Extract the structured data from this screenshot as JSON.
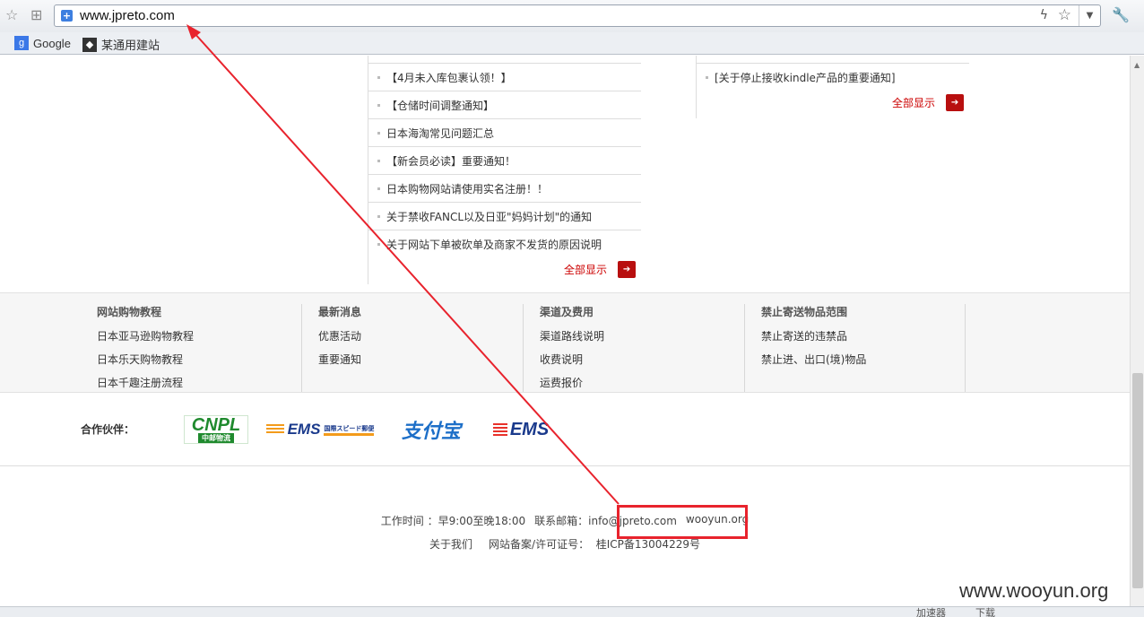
{
  "browser": {
    "url": "www.jpreto.com",
    "bookmarks": [
      {
        "label": "Google"
      },
      {
        "label": "某通用建站"
      }
    ],
    "status_items": [
      "加速器",
      "下载"
    ]
  },
  "news_left": {
    "items": [
      "【4月未入库包裹认领！】",
      "【仓储时间调整通知】",
      "日本海淘常见问题汇总",
      "【新会员必读】重要通知！",
      "日本购物网站请使用实名注册！！",
      "关于禁收FANCL以及日亚\"妈妈计划\"的通知",
      "关于网站下单被砍单及商家不发货的原因说明"
    ],
    "more_label": "全部显示"
  },
  "news_right": {
    "items": [
      "[关于停止接收kindle产品的重要通知]"
    ],
    "more_label": "全部显示"
  },
  "footer_columns": [
    {
      "title": "网站购物教程",
      "items": [
        "日本亚马逊购物教程",
        "日本乐天购物教程",
        "日本千趣注册流程"
      ]
    },
    {
      "title": "最新消息",
      "items": [
        "优惠活动",
        "重要通知"
      ]
    },
    {
      "title": "渠道及费用",
      "items": [
        "渠道路线说明",
        "收费说明",
        "运费报价"
      ]
    },
    {
      "title": "禁止寄送物品范围",
      "items": [
        "禁止寄送的违禁品",
        "禁止进、出口(境)物品"
      ]
    }
  ],
  "partners": {
    "label": "合作伙伴：",
    "logos": [
      {
        "name": "CNPL",
        "sub": "中邮物流",
        "color": "#1f8a2e"
      },
      {
        "name": "EMS",
        "sub": "国際スピード郵便",
        "color": "#1a3a8c"
      },
      {
        "name": "支付宝",
        "sub": "",
        "color": "#1d6fc8"
      },
      {
        "name": "EMS",
        "sub": "",
        "color": "#1a3a8c"
      }
    ]
  },
  "bottom": {
    "hours": "工作时间 ：早9:00至晚18:00",
    "email": "联系邮箱：info@jpreto.com",
    "injected": "wooyun.org",
    "about": "关于我们",
    "icp_label": "网站备案/许可证号：",
    "icp": "桂ICP备13004229号"
  },
  "watermark": "www.wooyun.org",
  "colors": {
    "accent_red": "#c00",
    "highlight": "#e8232d"
  }
}
